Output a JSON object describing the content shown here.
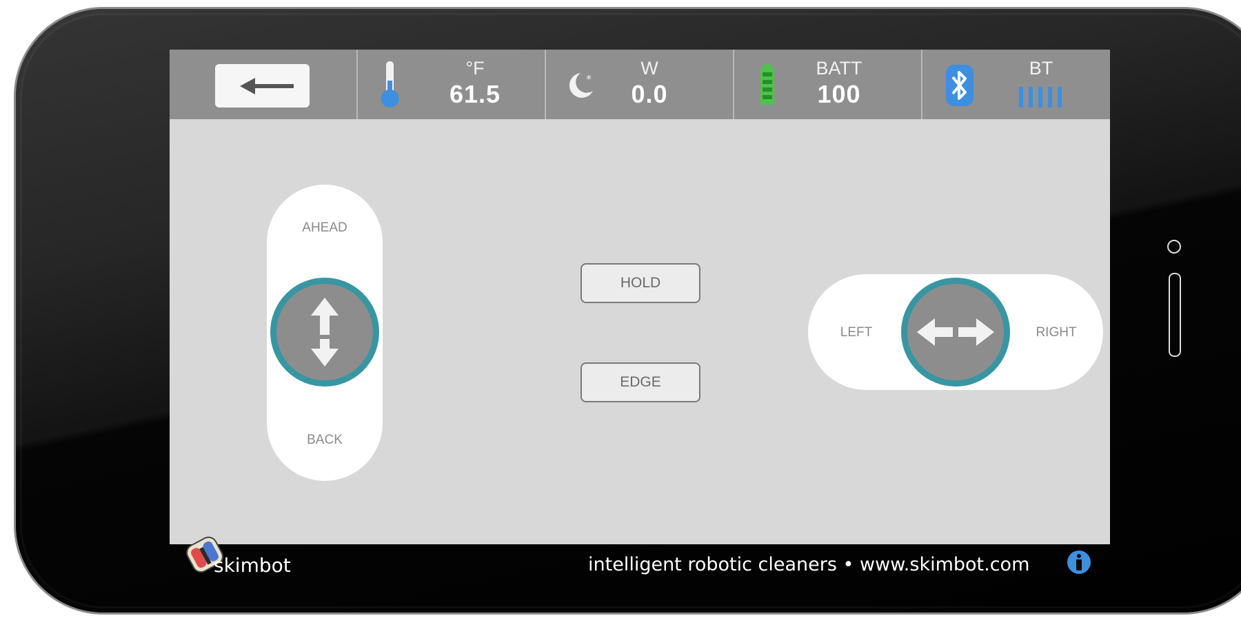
{
  "status": {
    "temperature": {
      "unit": "°F",
      "value": "61.5",
      "icon": "thermometer-icon"
    },
    "power": {
      "label": "W",
      "value": "0.0",
      "icon": "moon-star-icon"
    },
    "battery": {
      "label": "BATT",
      "value": "100",
      "icon": "battery-icon"
    },
    "bluetooth": {
      "label": "BT",
      "icon": "bluetooth-icon",
      "signal_bars": 5
    }
  },
  "controls": {
    "vertical": {
      "top_label": "AHEAD",
      "bottom_label": "BACK"
    },
    "horizontal": {
      "left_label": "LEFT",
      "right_label": "RIGHT"
    },
    "hold_label": "HOLD",
    "edge_label": "EDGE"
  },
  "footer": {
    "brand": "skimbot",
    "tagline": "intelligent robotic cleaners • www.skimbot.com"
  },
  "colors": {
    "accent_teal": "#3896a2",
    "battery_green": "#4cc44a",
    "bluetooth_blue": "#3d8fe0",
    "thermometer_blue": "#3d8fe0"
  }
}
